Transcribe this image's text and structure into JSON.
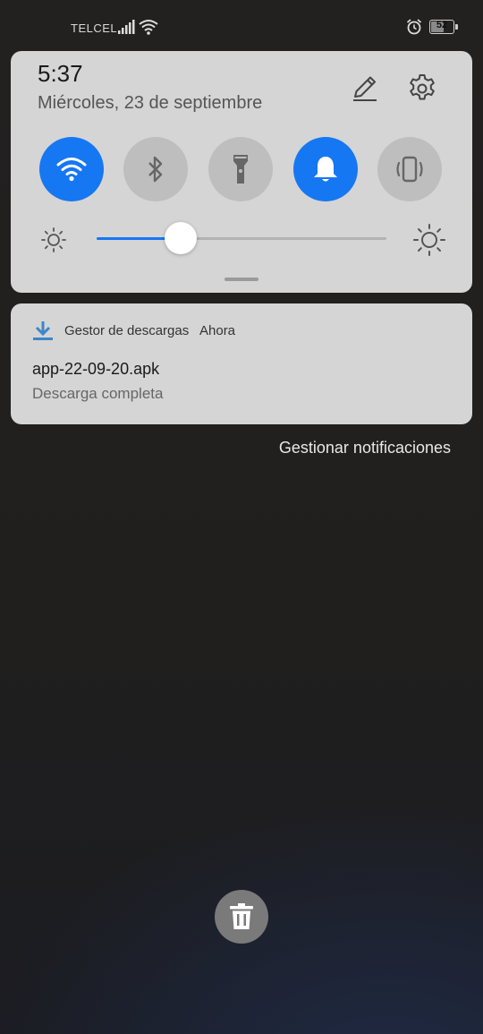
{
  "status_bar": {
    "carrier": "TELCEL",
    "battery_level": "52",
    "icons": [
      "signal-icon",
      "wifi-icon",
      "alarm-icon",
      "battery-icon"
    ]
  },
  "quick_settings": {
    "time": "5:37",
    "date": "Miércoles, 23 de septiembre",
    "tiles": [
      {
        "name": "wifi",
        "icon": "wifi-icon",
        "state": "on"
      },
      {
        "name": "bluetooth",
        "icon": "bluetooth-icon",
        "state": "off"
      },
      {
        "name": "flashlight",
        "icon": "flashlight-icon",
        "state": "off"
      },
      {
        "name": "sound",
        "icon": "bell-icon",
        "state": "on"
      },
      {
        "name": "vibrate",
        "icon": "vibrate-icon",
        "state": "off"
      }
    ],
    "brightness_level": 0.29,
    "accent_color": "#1677f3"
  },
  "notification": {
    "app_name": "Gestor de descargas",
    "time": "Ahora",
    "title": "app-22-09-20.apk",
    "text": "Descarga completa",
    "icon": "download-icon"
  },
  "manage_label": "Gestionar notificaciones",
  "clear_icon": "trash-icon"
}
